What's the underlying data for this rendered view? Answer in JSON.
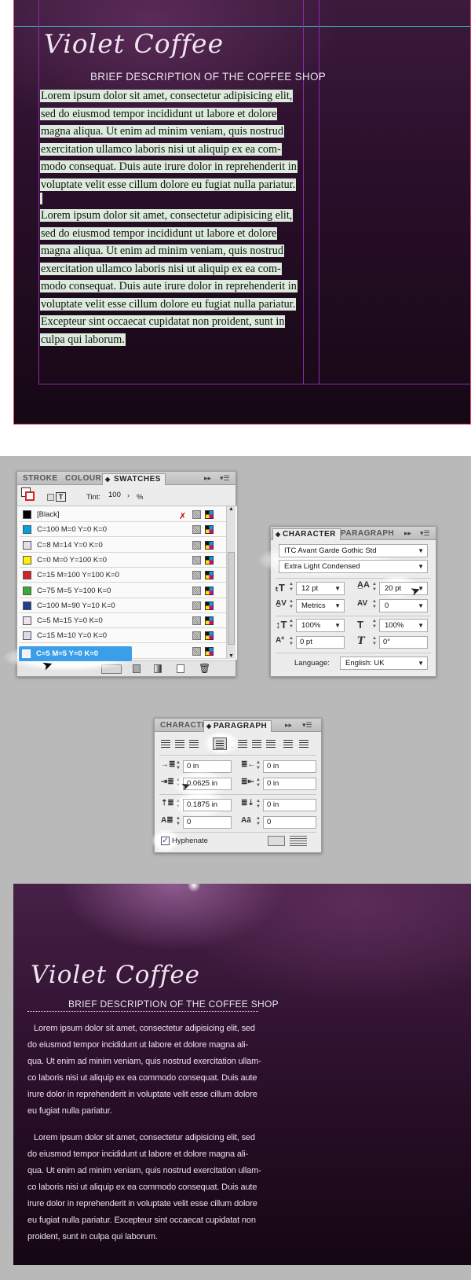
{
  "top_layout": {
    "logo": "Violet Coffee",
    "subtitle": "BRIEF DESCRIPTION OF THE COFFEE SHOP",
    "paragraph1_lines": [
      "Lorem ipsum dolor sit amet, consectetur adipisicing elit,",
      "sed do eiusmod tempor incididunt ut labore et dolore",
      "magna aliqua. Ut enim ad minim veniam, quis nostrud",
      "exercitation ullamco laboris nisi ut aliquip ex ea com-",
      "modo consequat. Duis aute irure dolor in reprehenderit in",
      "voluptate velit esse cillum dolore eu fugiat nulla pariatur."
    ],
    "paragraph2_lines": [
      "Lorem ipsum dolor sit amet, consectetur adipisicing elit,",
      "sed do eiusmod tempor incididunt ut labore et dolore",
      "magna aliqua. Ut enim ad minim veniam, quis nostrud",
      "exercitation ullamco laboris nisi ut aliquip ex ea com-",
      "modo consequat. Duis aute irure dolor in reprehenderit in",
      "voluptate velit esse cillum dolore eu fugiat nulla pariatur.",
      "Excepteur sint occaecat cupidatat non proident, sunt in",
      "culpa qui laborum."
    ]
  },
  "swatches_panel": {
    "tabs": [
      "STROKE",
      "COLOUR",
      "SWATCHES"
    ],
    "active_tab": "SWATCHES",
    "tint_label": "Tint:",
    "tint_value": "100",
    "tint_unit": "%",
    "swatches": [
      {
        "name": "[Black]",
        "color": "#000000"
      },
      {
        "name": "C=100 M=0 Y=0 K=0",
        "color": "#00a0e3"
      },
      {
        "name": "C=8 M=14 Y=0 K=0",
        "color": "#e9dcec"
      },
      {
        "name": "C=0 M=0 Y=100 K=0",
        "color": "#fff200"
      },
      {
        "name": "C=15 M=100 Y=100 K=0",
        "color": "#d2232a"
      },
      {
        "name": "C=75 M=5 Y=100 K=0",
        "color": "#3aa935"
      },
      {
        "name": "C=100 M=90 Y=10 K=0",
        "color": "#233e8b"
      },
      {
        "name": "C=5 M=15 Y=0 K=0",
        "color": "#f2e1ef"
      },
      {
        "name": "C=15 M=10 Y=0 K=0",
        "color": "#d9dcec"
      },
      {
        "name": "C=5 M=5 Y=0 K=0",
        "color": "#f2f1f8"
      }
    ],
    "selected_swatch": "C=5 M=5 Y=0 K=0",
    "selection_color": "#3a9fe8"
  },
  "character_panel": {
    "tabs": [
      "CHARACTER",
      "PARAGRAPH"
    ],
    "font_family": "ITC Avant Garde Gothic Std",
    "font_style": "Extra Light Condensed",
    "font_size": "12 pt",
    "leading": "20 pt",
    "kerning": "Metrics",
    "tracking": "0",
    "vertical_scale": "100%",
    "horizontal_scale": "100%",
    "baseline_shift": "0 pt",
    "skew": "0°",
    "language_label": "Language:",
    "language": "English: UK"
  },
  "paragraph_panel": {
    "tabs": [
      "CHARACTER",
      "PARAGRAPH"
    ],
    "left_indent": "0 in",
    "right_indent": "0 in",
    "first_line_indent": "0.0625 in",
    "last_line_right_indent": "0 in",
    "space_before": "0.1875 in",
    "space_after": "0 in",
    "drop_cap_lines": "0",
    "drop_cap_chars": "0",
    "hyphenate_label": "Hyphenate",
    "hyphenate_checked": true
  },
  "bottom_layout": {
    "logo": "Violet Coffee",
    "subtitle": "BRIEF DESCRIPTION OF THE COFFEE SHOP",
    "paragraph1_lines": [
      "Lorem ipsum dolor sit amet, consectetur adipisicing elit, sed",
      "do eiusmod tempor incididunt ut labore et dolore magna ali-",
      "qua. Ut enim ad minim veniam, quis nostrud exercitation ullam-",
      "co laboris nisi ut aliquip ex ea commodo consequat. Duis aute",
      "irure dolor in reprehenderit in voluptate velit esse cillum dolore",
      "eu fugiat nulla pariatur."
    ],
    "paragraph2_lines": [
      "Lorem ipsum dolor sit amet, consectetur adipisicing elit, sed",
      "do eiusmod tempor incididunt ut labore et dolore magna ali-",
      "qua. Ut enim ad minim veniam, quis nostrud exercitation ullam-",
      "co laboris nisi ut aliquip ex ea commodo consequat. Duis aute",
      "irure dolor in reprehenderit in voluptate velit esse cillum dolore",
      "eu fugiat nulla pariatur. Excepteur sint occaecat cupidatat non",
      "proident, sunt in culpa qui laborum."
    ]
  }
}
